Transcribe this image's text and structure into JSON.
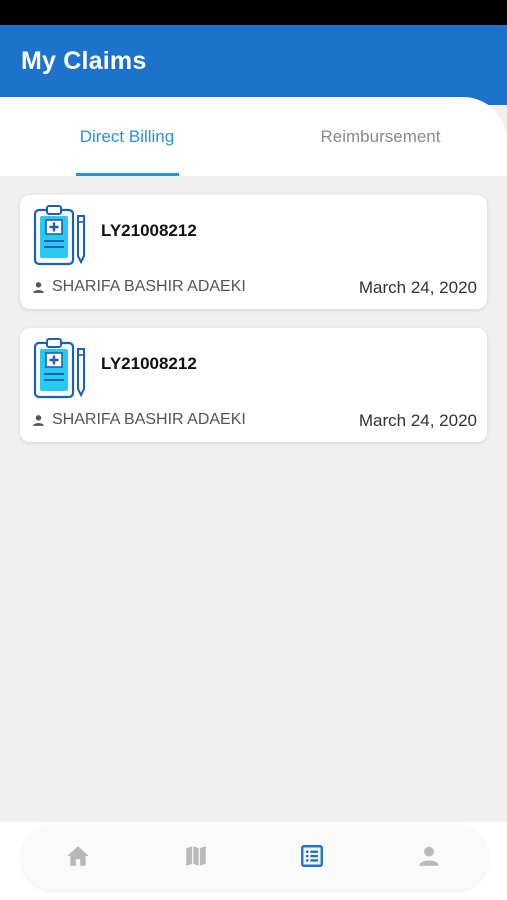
{
  "header": {
    "title": "My Claims"
  },
  "tabs": [
    {
      "label": "Direct Billing",
      "active": true
    },
    {
      "label": "Reimbursement",
      "active": false
    }
  ],
  "claims": [
    {
      "id": "LY21008212",
      "name": "SHARIFA BASHIR ADAEKI",
      "date": "March 24, 2020",
      "icon": "clipboard-medical-icon"
    },
    {
      "id": "LY21008212",
      "name": "SHARIFA BASHIR ADAEKI",
      "date": "March 24, 2020",
      "icon": "clipboard-medical-icon"
    }
  ],
  "bottom_nav": [
    {
      "icon": "home-icon",
      "active": false
    },
    {
      "icon": "map-icon",
      "active": false
    },
    {
      "icon": "list-icon",
      "active": true
    },
    {
      "icon": "profile-icon",
      "active": false
    }
  ],
  "colors": {
    "header": "#1d73cc",
    "accent": "#2a8ee2",
    "nav_inactive": "#b8b8b8",
    "nav_active": "#1d73cc"
  }
}
